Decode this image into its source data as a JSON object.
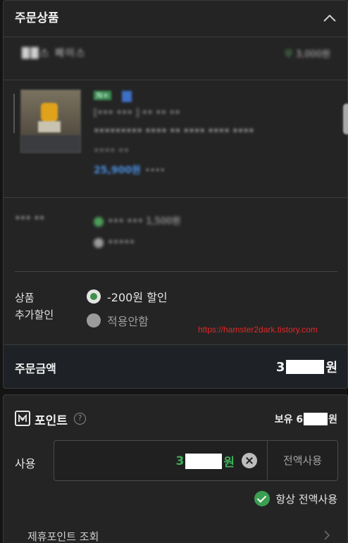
{
  "order": {
    "title": "주문상품",
    "collapse_icon": "chevron-up-icon"
  },
  "store": {
    "name": "██스 페이스",
    "shipping_prefix": "무",
    "shipping_value": "3,000원"
  },
  "product": {
    "tag": "N+",
    "line1": "[••• ••• ] •• •• ••",
    "line2": "••••••••• •••• •• •••• •••• ••••",
    "line3": "•••• ••",
    "price": "25,900원",
    "price_sub": "••••"
  },
  "option_blurred": {
    "label": "••• ••",
    "options": [
      "••• ••• 1,500원",
      "•••••"
    ]
  },
  "discount": {
    "label_line1": "상품",
    "label_line2": "추가할인",
    "options": [
      "-200원 할인",
      "적용안함"
    ],
    "selected_index": 0
  },
  "watermark": "https://hamster2dark.tistory.com",
  "total": {
    "label": "주문금액",
    "value_prefix": "3",
    "value_suffix": "원"
  },
  "points": {
    "title": "포인트",
    "help": "?",
    "balance_prefix": "보유 6",
    "balance_suffix": "원",
    "use_label": "사용",
    "use_prefix": "3",
    "use_suffix": "원",
    "use_all_label": "전액사용",
    "always_label": "항상 전액사용",
    "partner_label": "제휴포인트 조회"
  },
  "colors": {
    "accent_green": "#3fae5a",
    "background": "#242424",
    "watermark_red": "#e02828"
  }
}
